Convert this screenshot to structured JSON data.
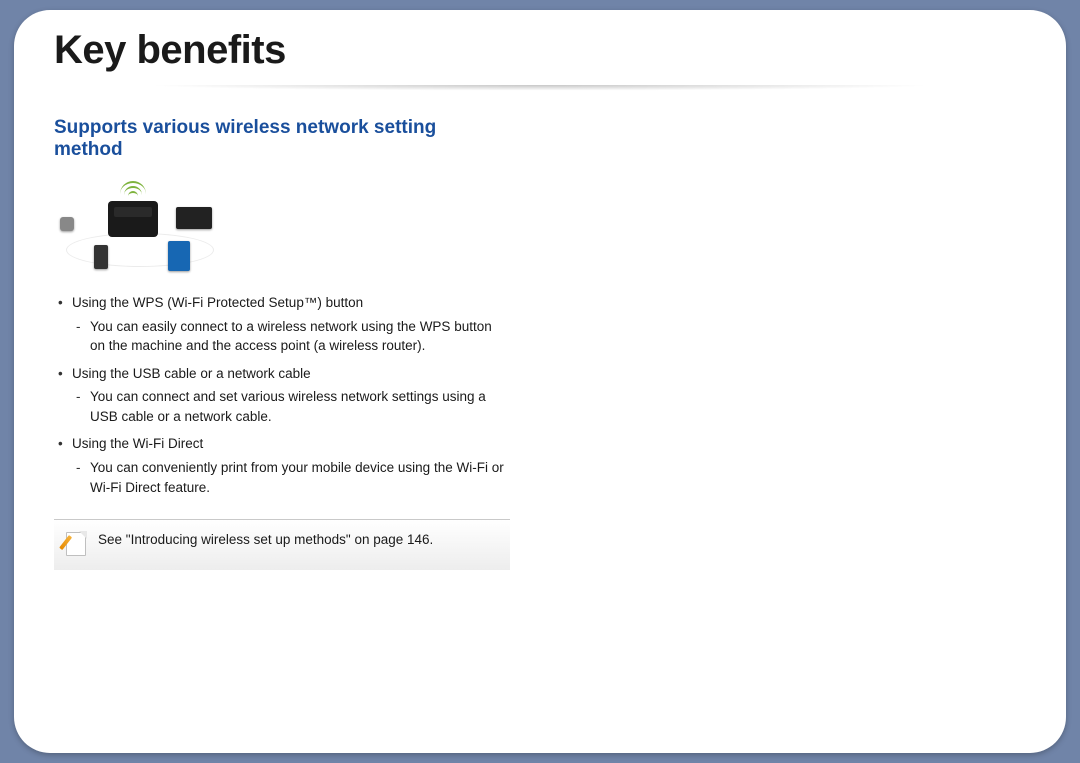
{
  "title": "Key benefits",
  "subhead": "Supports various wireless network setting method",
  "bullets": [
    {
      "head": "Using the WPS (Wi-Fi Protected Setup™) button",
      "sub": "You can easily connect to a wireless network using the WPS button on the machine and the access point (a wireless router)."
    },
    {
      "head": "Using the USB cable or a network cable",
      "sub": "You can connect and set various wireless network settings using a USB cable or a network cable."
    },
    {
      "head": "Using the Wi-Fi Direct",
      "sub": "You can conveniently print from your mobile device using the Wi-Fi or Wi-Fi Direct feature."
    }
  ],
  "note": "See \"Introducing wireless set up methods\" on page 146."
}
